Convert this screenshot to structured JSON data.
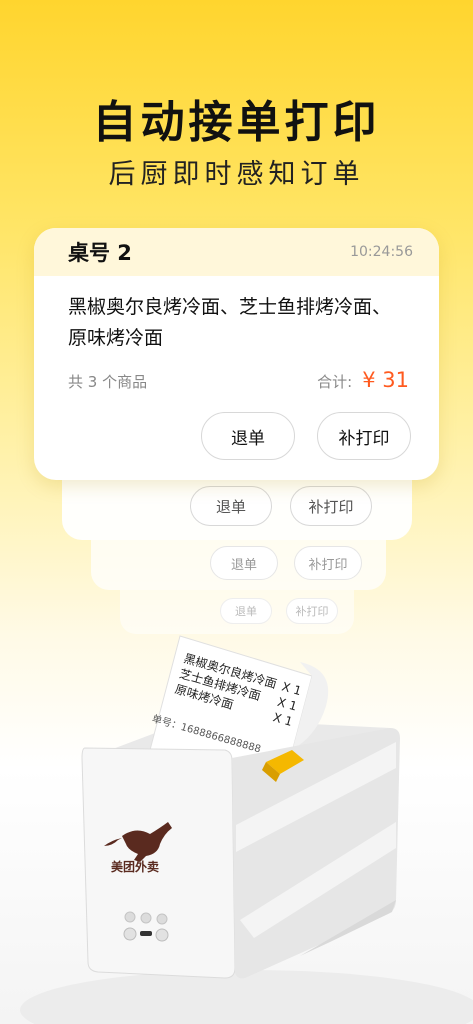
{
  "hero": {
    "title": "自动接单打印",
    "subtitle": "后厨即时感知订单"
  },
  "order_card": {
    "table_label": "桌号 2",
    "time": "10:24:56",
    "items_text": "黑椒奥尔良烤冷面、芝士鱼排烤冷面、原味烤冷面",
    "count_text": "共 3 个商品",
    "total_label": "合计:",
    "total_amount": "¥ 31",
    "refund_label": "退单",
    "reprint_label": "补打印"
  },
  "stacked_cards": [
    {
      "refund_label": "退单",
      "reprint_label": "补打印"
    },
    {
      "refund_label": "退单",
      "reprint_label": "补打印"
    },
    {
      "refund_label": "退单",
      "reprint_label": "补打印"
    }
  ],
  "receipt": {
    "lines": [
      {
        "name": "黑椒奥尔良烤冷面",
        "qty": "X 1"
      },
      {
        "name": "芝士鱼排烤冷面",
        "qty": "X 1"
      },
      {
        "name": "原味烤冷面",
        "qty": "X 1"
      }
    ],
    "order_no": "单号：1688866888888"
  },
  "printer": {
    "brand": "美团外卖"
  },
  "colors": {
    "accent": "#ffd52e",
    "price": "#ff5a1f",
    "card_header": "#fff7da",
    "printer_button": "#f5b800"
  }
}
